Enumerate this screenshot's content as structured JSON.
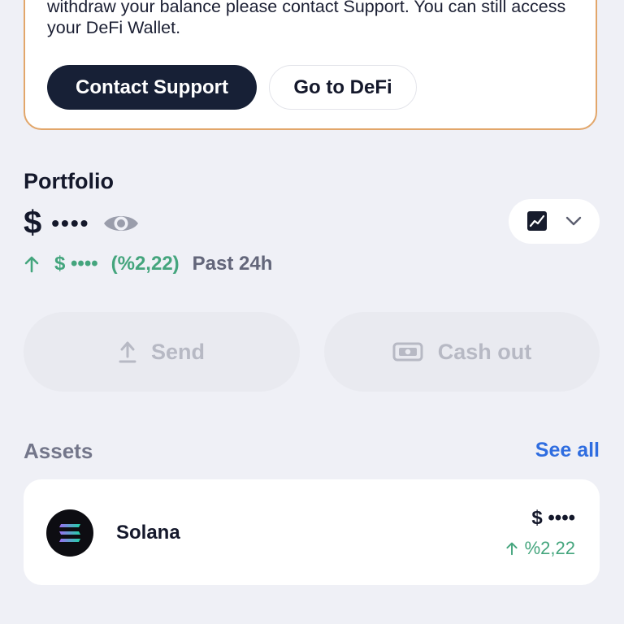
{
  "banner": {
    "message": "Your account is now restricted from buying, selling and trading. To withdraw your balance please contact Support. You can still access your DeFi Wallet.",
    "contact_support_label": "Contact Support",
    "go_to_defi_label": "Go to DeFi"
  },
  "portfolio": {
    "title": "Portfolio",
    "currency_symbol": "$",
    "balance_masked": "••••",
    "change_amount": "$ ••••",
    "change_percent": "(%2,22)",
    "change_period": "Past 24h"
  },
  "actions": {
    "send_label": "Send",
    "cashout_label": "Cash out"
  },
  "assets": {
    "title": "Assets",
    "see_all_label": "See all",
    "items": [
      {
        "name": "Solana",
        "value_masked": "$ ••••",
        "change": "%2,22",
        "icon": "solana-logo"
      }
    ]
  },
  "icons": {
    "eye": "eye-icon",
    "chart": "chart-line-icon",
    "chevron": "chevron-down-icon",
    "send": "upload-arrow-icon",
    "cashout": "banknote-icon",
    "trend": "up-arrow-icon"
  },
  "colors": {
    "background": "#eff0f6",
    "primary_button": "#172036",
    "banner_border": "#e2a66a",
    "positive": "#44a57d",
    "link": "#2f6de0"
  }
}
